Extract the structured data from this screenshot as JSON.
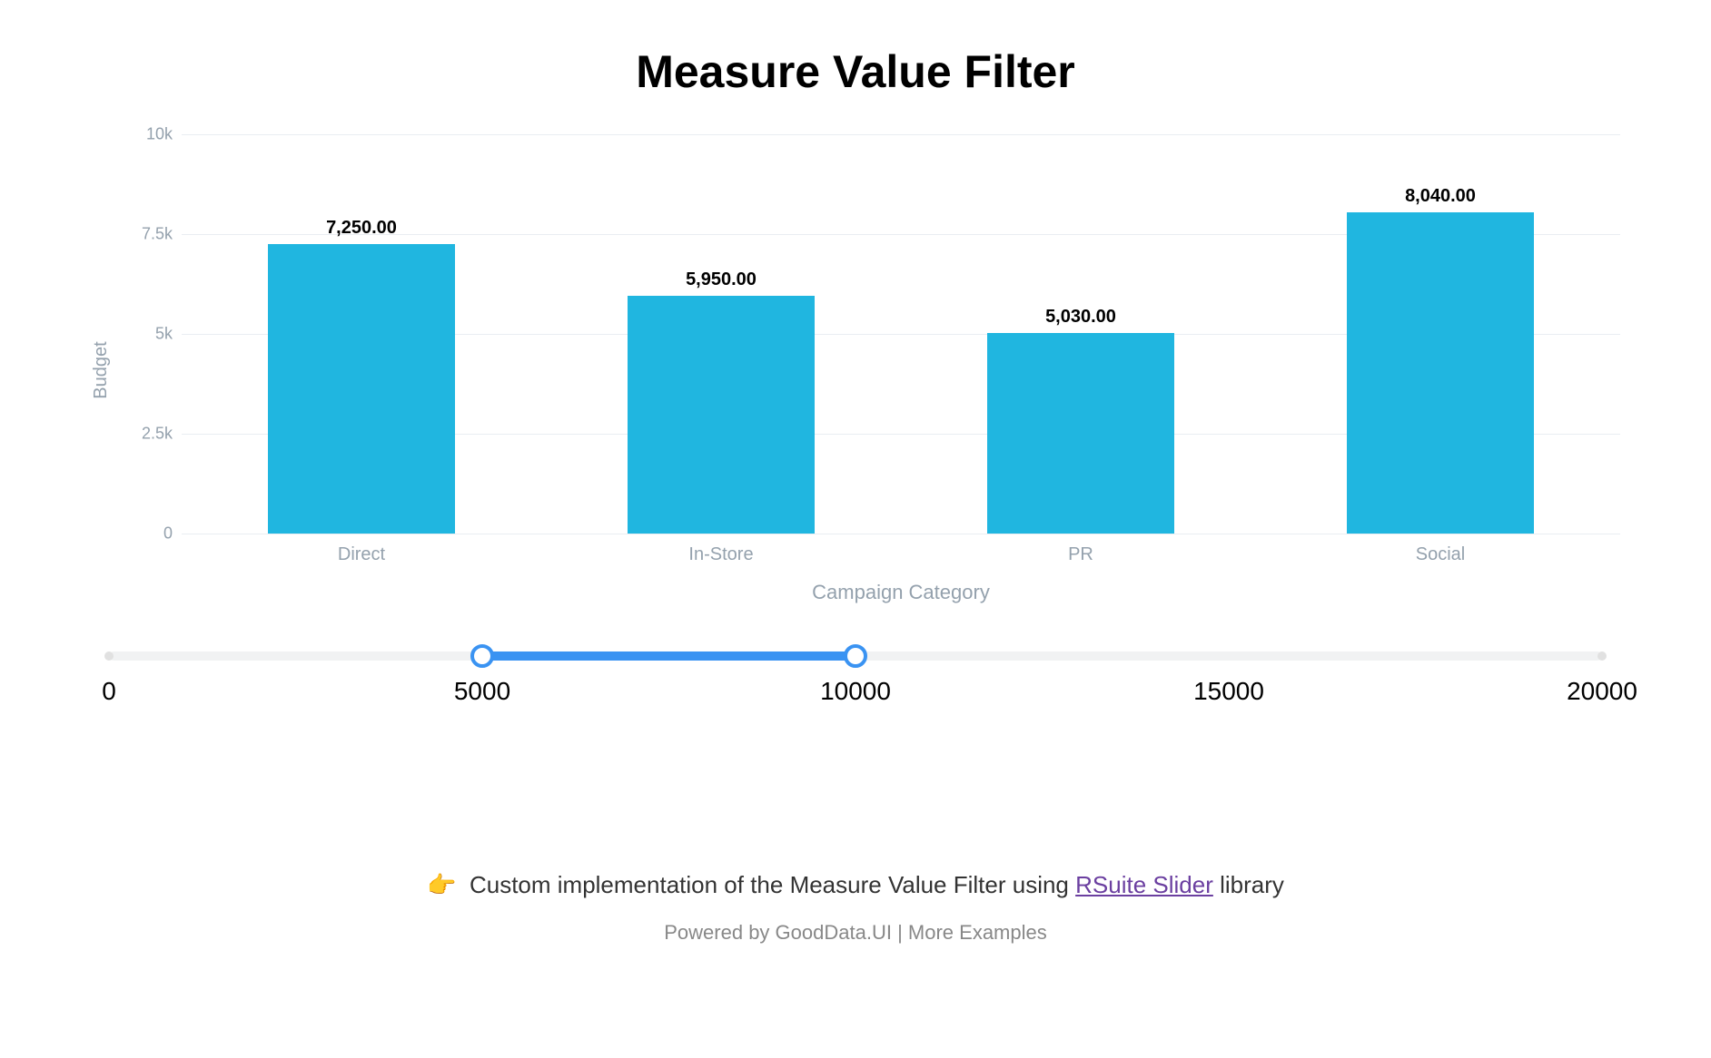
{
  "title": "Measure Value Filter",
  "chart_data": {
    "type": "bar",
    "title": "Measure Value Filter",
    "xlabel": "Campaign Category",
    "ylabel": "Budget",
    "categories": [
      "Direct",
      "In-Store",
      "PR",
      "Social"
    ],
    "values": [
      7250.0,
      5950.0,
      5030.0,
      8040.0
    ],
    "value_labels": [
      "7,250.00",
      "5,950.00",
      "5,030.00",
      "8,040.00"
    ],
    "ylim": [
      0,
      10000
    ],
    "y_ticks": [
      {
        "value": 0,
        "label": "0"
      },
      {
        "value": 2500,
        "label": "2.5k"
      },
      {
        "value": 5000,
        "label": "5k"
      },
      {
        "value": 7500,
        "label": "7.5k"
      },
      {
        "value": 10000,
        "label": "10k"
      }
    ],
    "bar_color": "#20b6e0"
  },
  "slider": {
    "min": 0,
    "max": 20000,
    "from": 5000,
    "to": 10000,
    "ticks": [
      {
        "value": 0,
        "label": "0"
      },
      {
        "value": 5000,
        "label": "5000"
      },
      {
        "value": 10000,
        "label": "10000"
      },
      {
        "value": 15000,
        "label": "15000"
      },
      {
        "value": 20000,
        "label": "20000"
      }
    ]
  },
  "footer": {
    "emoji": "👉",
    "text_before": "Custom implementation of the Measure Value Filter using ",
    "link_text": "RSuite Slider",
    "text_after": " library",
    "powered_prefix": "Powered by ",
    "powered_brand": "GoodData.UI",
    "sep": " | ",
    "more": "More Examples"
  }
}
